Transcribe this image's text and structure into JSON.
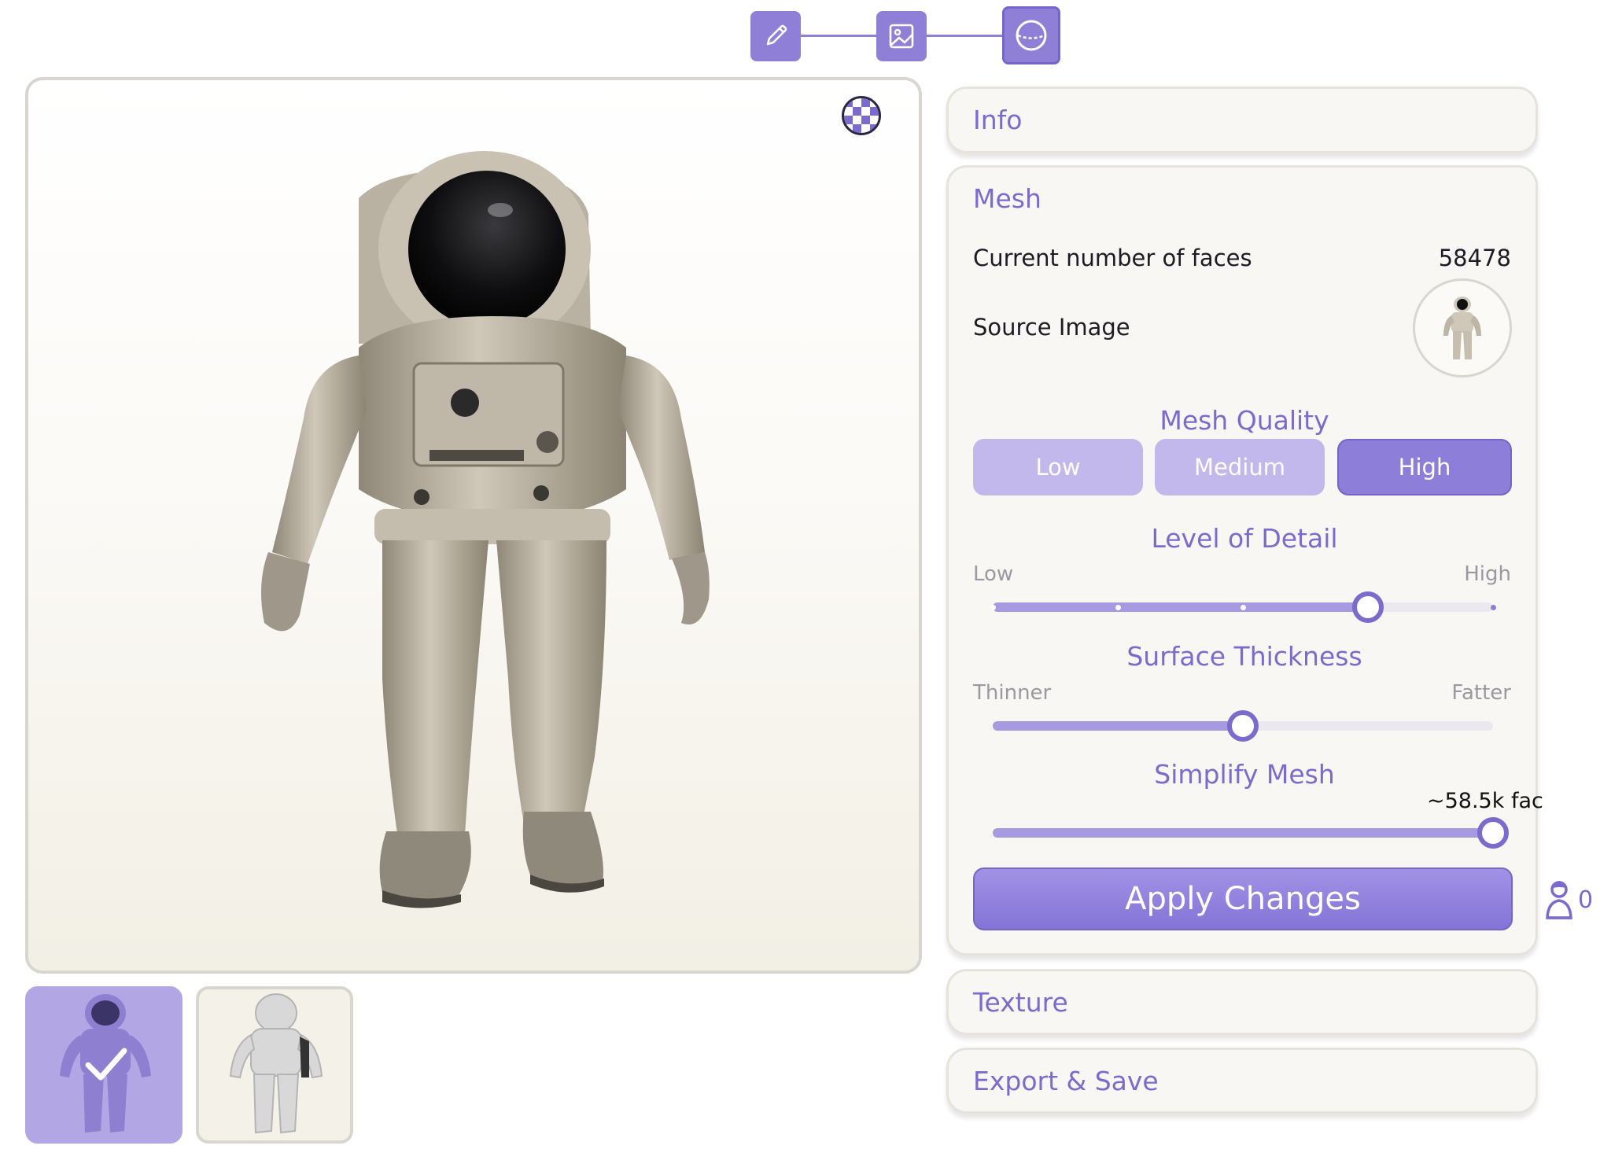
{
  "stepper": {
    "steps": [
      {
        "icon": "pencil-icon",
        "active": false
      },
      {
        "icon": "image-icon",
        "active": false
      },
      {
        "icon": "mesh-sphere-icon",
        "active": true
      }
    ]
  },
  "viewer": {
    "background_toggle_icon": "checkerboard-icon",
    "subject": "astronaut-model"
  },
  "thumbnails": [
    {
      "name": "textured-model",
      "selected": true,
      "selected_icon": "checkmark-icon"
    },
    {
      "name": "untextured-model",
      "selected": false
    }
  ],
  "panel": {
    "info": {
      "title": "Info"
    },
    "mesh": {
      "title": "Mesh",
      "faces_label": "Current number of faces",
      "faces_value": "58478",
      "source_label": "Source Image",
      "quality": {
        "label": "Mesh Quality",
        "options": [
          "Low",
          "Medium",
          "High"
        ],
        "selected": "High"
      },
      "level_of_detail": {
        "label": "Level of Detail",
        "min_label": "Low",
        "max_label": "High",
        "steps": 5,
        "value_step": 3
      },
      "surface_thickness": {
        "label": "Surface Thickness",
        "min_label": "Thinner",
        "max_label": "Fatter",
        "value": 0.5
      },
      "simplify": {
        "label": "Simplify Mesh",
        "value_text": "~58.5k fac",
        "value": 1.0
      },
      "apply_label": "Apply Changes"
    },
    "texture": {
      "title": "Texture"
    },
    "export": {
      "title": "Export & Save"
    }
  },
  "credits": {
    "icon": "user-bust-icon",
    "count": "0"
  },
  "colors": {
    "accent": "#7b6bcc",
    "accent_light": "#c2b8ec",
    "accent_fill": "#a79ae0",
    "panel_bg": "#f9f7f3",
    "border": "#d9d6d0"
  }
}
